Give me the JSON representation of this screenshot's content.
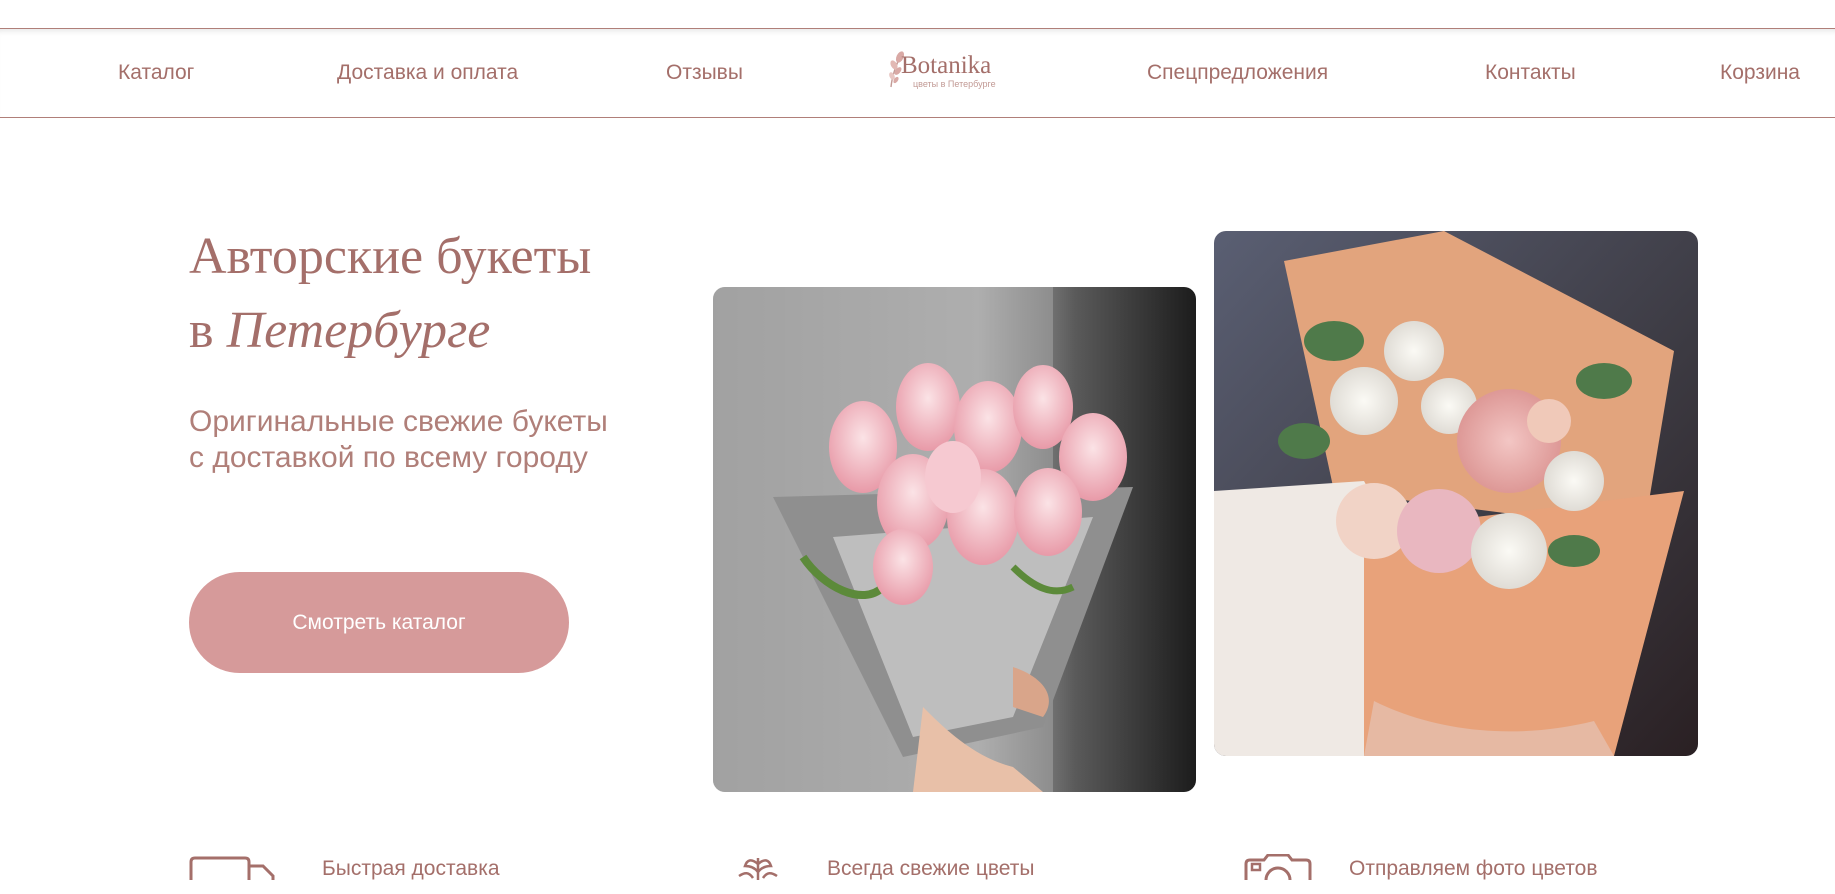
{
  "nav": {
    "items": [
      {
        "label": "Каталог"
      },
      {
        "label": "Доставка и оплата"
      },
      {
        "label": "Отзывы"
      },
      {
        "label": "Спецпредложения"
      },
      {
        "label": "Контакты"
      },
      {
        "label": "Корзина"
      }
    ],
    "logo": {
      "word": "Botanika",
      "tagline": "цветы в Петербурге"
    }
  },
  "hero": {
    "title_line1": "Авторские букеты",
    "title_prefix": "в",
    "title_italic": "Петербурге",
    "subtitle_line1": "Оригинальные свежие букеты",
    "subtitle_line2": "с доставкой по всему городу",
    "cta_label": "Смотреть каталог",
    "photos": [
      {
        "icon": "tulip-bouquet-photo"
      },
      {
        "icon": "rose-bouquet-photo"
      }
    ]
  },
  "features": [
    {
      "label": "Быстрая доставка",
      "icon": "truck-icon"
    },
    {
      "label": "Всегда свежие цветы",
      "icon": "flower-icon"
    },
    {
      "label": "Отправляем фото цветов",
      "icon": "camera-icon"
    }
  ],
  "colors": {
    "accent": "#a46f6a",
    "button": "#d69a9a",
    "background": "#ffffff"
  }
}
